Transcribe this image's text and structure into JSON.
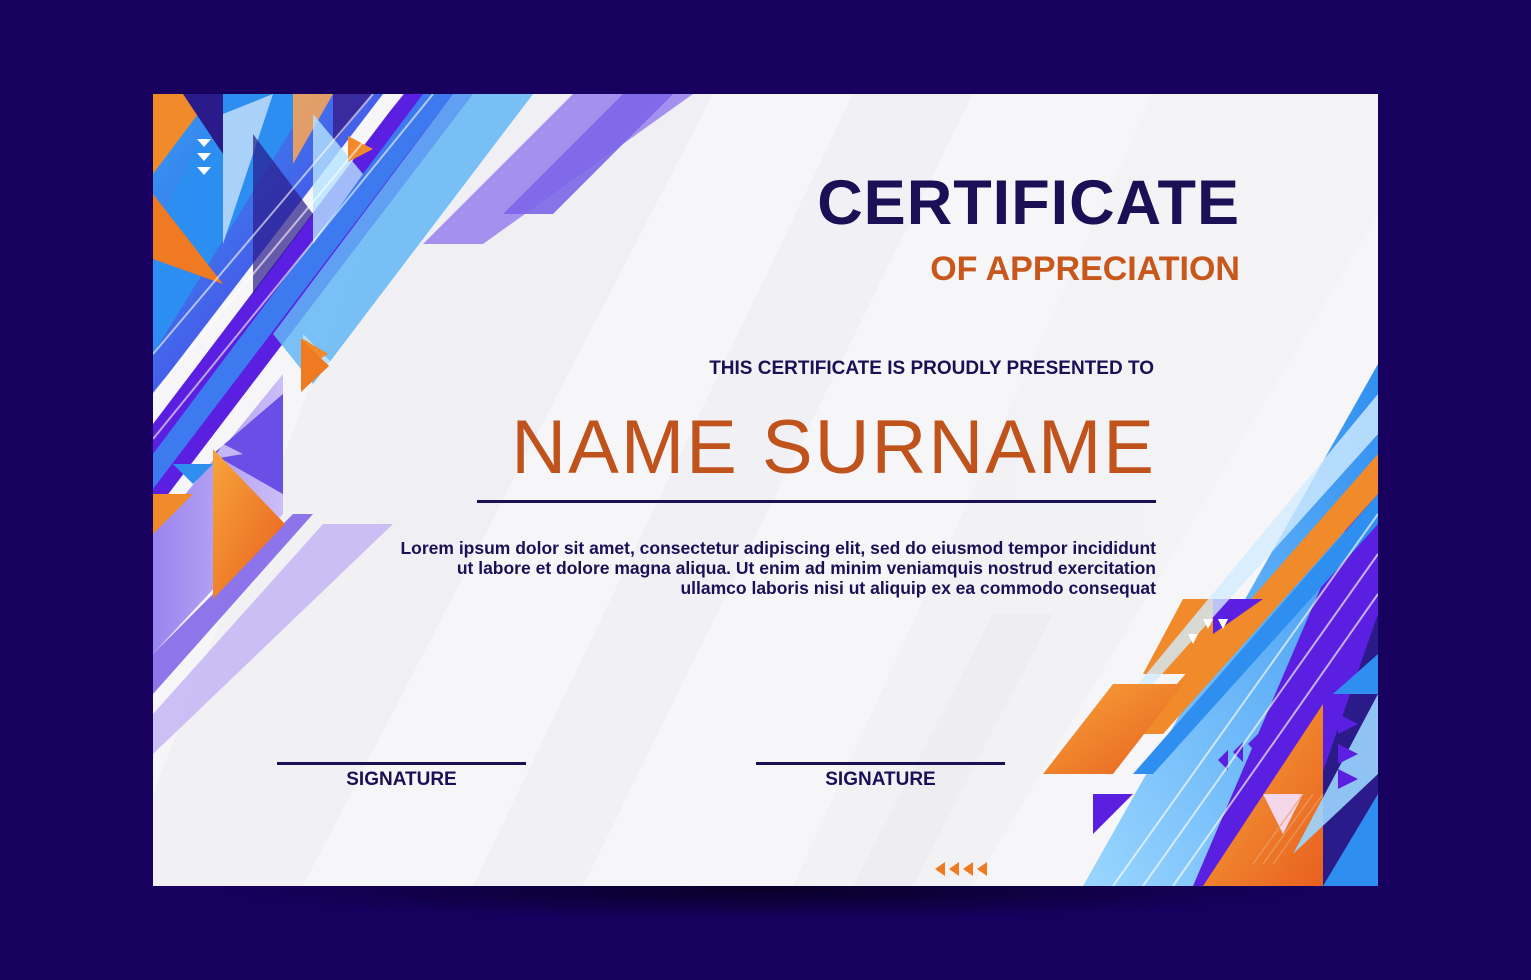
{
  "certificate": {
    "title": "CERTIFICATE",
    "subtitle": "OF APPRECIATION",
    "presented_to": "THIS CERTIFICATE IS PROUDLY PRESENTED TO",
    "recipient_name": "NAME SURNAME",
    "body_lines": [
      "Lorem ipsum dolor sit amet, consectetur adipiscing elit, sed do eiusmod tempor incididunt",
      "ut labore et dolore magna aliqua. Ut enim ad minim veniamquis nostrud exercitation",
      "ullamco laboris nisi ut aliquip ex ea commodo consequat"
    ],
    "signatures": [
      {
        "label": "SIGNATURE"
      },
      {
        "label": "SIGNATURE"
      }
    ]
  },
  "colors": {
    "background": "#17005e",
    "card": "#f6f6f9",
    "navy_text": "#1b0f55",
    "orange_accent": "#c8571c",
    "violet": "#5a1fe0",
    "sky_blue": "#4aa8f0",
    "lavender": "#a68ff0",
    "orange": "#f08a2a"
  }
}
